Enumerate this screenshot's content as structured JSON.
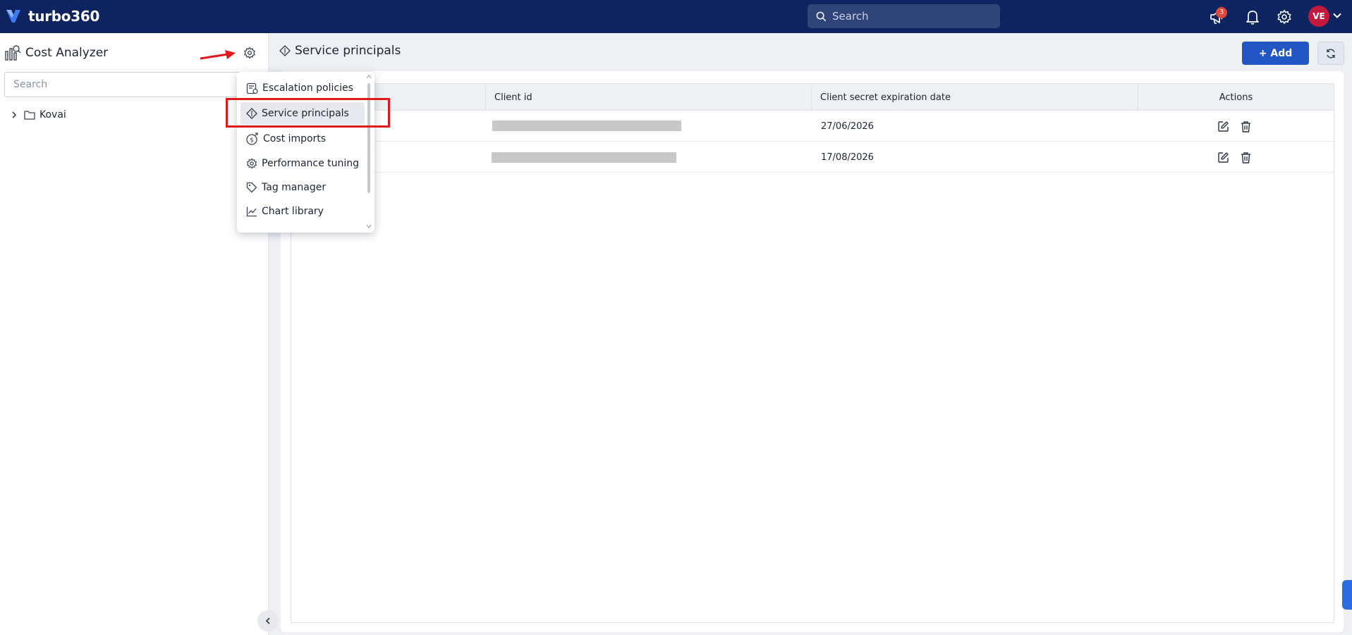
{
  "app": {
    "brand": "turbo360",
    "search_placeholder": "Search",
    "notification_badge": "3",
    "user_initials": "VE"
  },
  "sidebar": {
    "title": "Cost Analyzer",
    "search_placeholder": "Search",
    "tree": [
      {
        "label": "Kovai"
      }
    ]
  },
  "settings_menu": {
    "items": [
      {
        "label": "Escalation policies",
        "icon": "escalation-policy-icon"
      },
      {
        "label": "Service principals",
        "icon": "service-principal-icon",
        "active": true
      },
      {
        "label": "Cost imports",
        "icon": "cost-import-icon"
      },
      {
        "label": "Performance tuning",
        "icon": "gear-icon"
      },
      {
        "label": "Tag manager",
        "icon": "tag-icon"
      },
      {
        "label": "Chart library",
        "icon": "chart-icon"
      }
    ]
  },
  "page": {
    "title": "Service principals",
    "add_label": "+ Add"
  },
  "table": {
    "columns": [
      "",
      "Client id",
      "Client secret expiration date",
      "Actions"
    ],
    "rows": [
      {
        "client_id": "",
        "expiration": "27/06/2026"
      },
      {
        "client_id": "",
        "expiration": "17/08/2026"
      }
    ]
  },
  "colors": {
    "topbar": "#0e2461",
    "primary": "#2356c5",
    "highlight": "#e01a1a",
    "avatar": "#c3193f"
  }
}
